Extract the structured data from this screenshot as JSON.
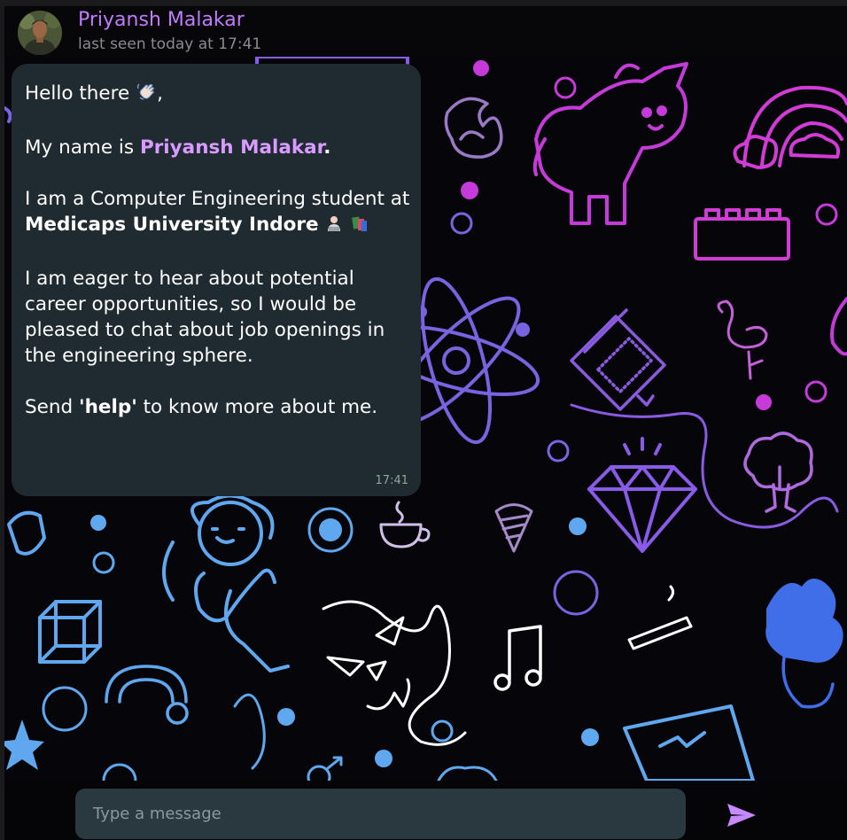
{
  "contact": {
    "name": "Priyansh Malakar",
    "last_seen": "last seen today at 17:41"
  },
  "message": {
    "greeting": "Hello there",
    "greeting_comma": ",",
    "name_prefix": "My name is ",
    "name": "Priyansh Malakar",
    "name_suffix": ".",
    "study_prefix": "I am a Computer Engineering student at ",
    "university": "Medicaps University Indore",
    "career": "I am eager to hear about potential career opportunities, so I would be pleased to chat about job openings in the engineering sphere.",
    "help_prefix": "Send ",
    "help_keyword": "'help'",
    "help_suffix": " to know more about me.",
    "time": "17:41"
  },
  "composer": {
    "placeholder": "Type a message"
  },
  "icons": {
    "avatar": "avatar-photo",
    "wave": "waving-hand-icon",
    "study": "technologist-icon",
    "books": "books-icon",
    "send": "send-icon"
  },
  "colors": {
    "accent": "#c27bff",
    "bubble": "#202b31",
    "input": "#2a3840",
    "send": "#c58aff"
  }
}
